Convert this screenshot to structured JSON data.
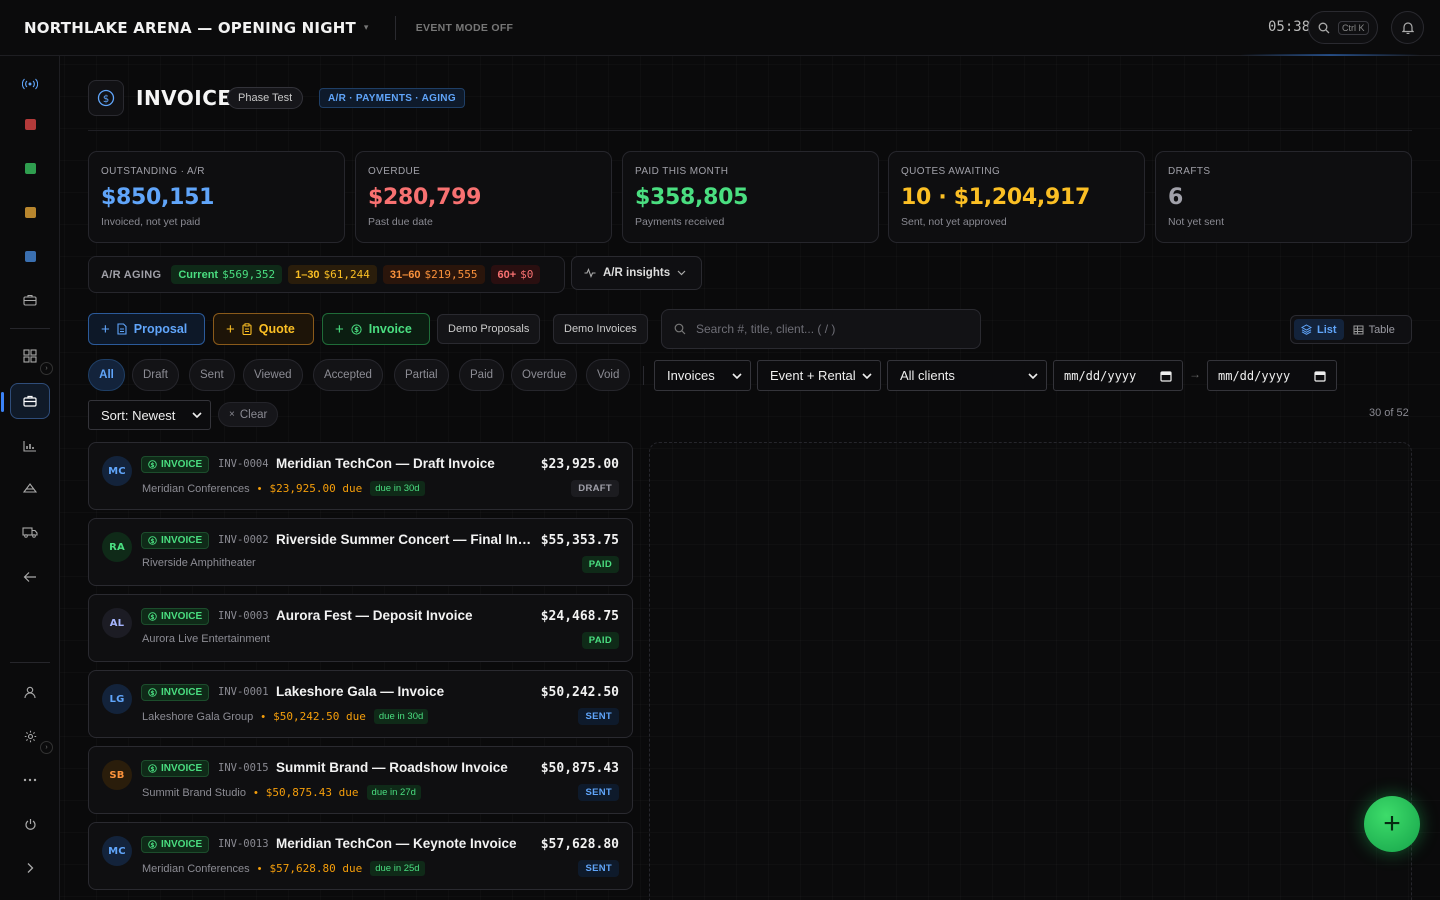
{
  "topbar": {
    "brand": "NORTHLAKE ARENA — OPENING NIGHT",
    "event_mode": "EVENT MODE OFF",
    "clock": "05:38",
    "search_shortcut": "Ctrl K"
  },
  "header": {
    "title": "INVOICES",
    "phase_chip": "Phase Test",
    "section_chip": "A/R · PAYMENTS · AGING"
  },
  "kpis": [
    {
      "label": "OUTSTANDING · A/R",
      "value": "$850,151",
      "sub": "Invoiced, not yet paid",
      "color": "#60a5fa"
    },
    {
      "label": "OVERDUE",
      "value": "$280,799",
      "sub": "Past due date",
      "color": "#f87171"
    },
    {
      "label": "PAID THIS MONTH",
      "value": "$358,805",
      "sub": "Payments received",
      "color": "#4ade80"
    },
    {
      "label": "QUOTES AWAITING",
      "value": "10 · $1,204,917",
      "sub": "Sent, not yet approved",
      "color": "#fbbf24"
    },
    {
      "label": "DRAFTS",
      "value": "6",
      "sub": "Not yet sent",
      "color": "#a1a1aa"
    }
  ],
  "aging": {
    "label": "A/R AGING",
    "buckets": [
      {
        "name": "Current",
        "value": "$569,352"
      },
      {
        "name": "1–30",
        "value": "$61,244"
      },
      {
        "name": "31–60",
        "value": "$219,555"
      },
      {
        "name": "60+",
        "value": "$0"
      }
    ],
    "insights_label": "A/R insights"
  },
  "actions": {
    "proposal": "Proposal",
    "quote": "Quote",
    "invoice": "Invoice",
    "demo_proposals": "Demo Proposals",
    "demo_invoices": "Demo Invoices",
    "search_placeholder": "Search #, title, client... ( / )",
    "view_list": "List",
    "view_table": "Table"
  },
  "filters": {
    "status_pills": [
      "All",
      "Draft",
      "Sent",
      "Viewed",
      "Accepted",
      "Partial",
      "Paid",
      "Overdue",
      "Void"
    ],
    "doc_type": "Invoices",
    "scope": "Event + Rental",
    "client": "All clients",
    "date_from": "mm/dd/yyyy",
    "date_to": "mm/dd/yyyy",
    "sort": "Sort: Newest",
    "clear": "Clear",
    "count": "30 of 52"
  },
  "invoices": [
    {
      "initials": "MC",
      "type": "INVOICE",
      "number": "INV-0004",
      "title": "Meridian TechCon — Draft Invoice",
      "client": "Meridian Conferences",
      "due_amount": "$23,925.00",
      "due_word": "due",
      "due_in": "due in 30d",
      "amount": "$23,925.00",
      "status": "DRAFT"
    },
    {
      "initials": "RA",
      "type": "INVOICE",
      "number": "INV-0002",
      "title": "Riverside Summer Concert — Final Invoice",
      "client": "Riverside Amphitheater",
      "due_amount": "",
      "due_word": "",
      "due_in": "",
      "amount": "$55,353.75",
      "status": "PAID"
    },
    {
      "initials": "AL",
      "type": "INVOICE",
      "number": "INV-0003",
      "title": "Aurora Fest — Deposit Invoice",
      "client": "Aurora Live Entertainment",
      "due_amount": "",
      "due_word": "",
      "due_in": "",
      "amount": "$24,468.75",
      "status": "PAID"
    },
    {
      "initials": "LG",
      "type": "INVOICE",
      "number": "INV-0001",
      "title": "Lakeshore Gala — Invoice",
      "client": "Lakeshore Gala Group",
      "due_amount": "$50,242.50",
      "due_word": "due",
      "due_in": "due in 30d",
      "amount": "$50,242.50",
      "status": "SENT"
    },
    {
      "initials": "SB",
      "type": "INVOICE",
      "number": "INV-0015",
      "title": "Summit Brand — Roadshow Invoice",
      "client": "Summit Brand Studio",
      "due_amount": "$50,875.43",
      "due_word": "due",
      "due_in": "due in 27d",
      "amount": "$50,875.43",
      "status": "SENT"
    },
    {
      "initials": "MC",
      "type": "INVOICE",
      "number": "INV-0013",
      "title": "Meridian TechCon — Keynote Invoice",
      "client": "Meridian Conferences",
      "due_amount": "$57,628.80",
      "due_word": "due",
      "due_in": "due in 25d",
      "amount": "$57,628.80",
      "status": "SENT"
    }
  ]
}
